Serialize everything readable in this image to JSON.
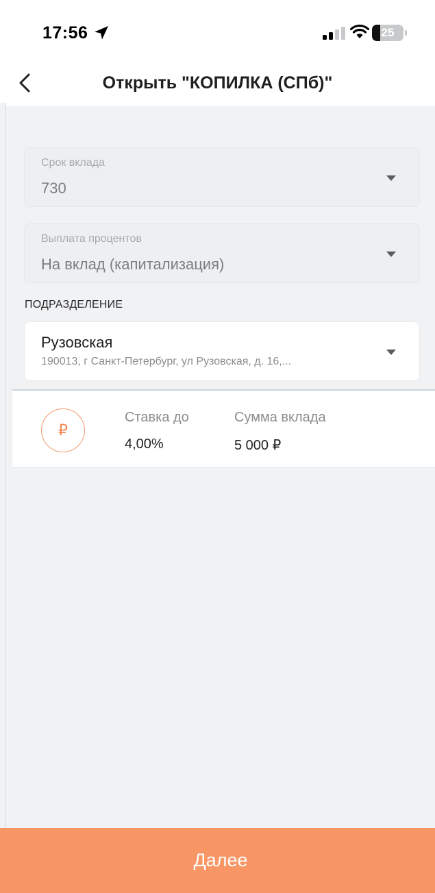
{
  "status_bar": {
    "time": "17:56",
    "battery": "25",
    "battery_level": 0.25
  },
  "header": {
    "title": "Открыть \"КОПИЛКА (СПб)\""
  },
  "form": {
    "term": {
      "label": "Срок вклада",
      "value": "730"
    },
    "interest_payment": {
      "label": "Выплата процентов",
      "value": "На вклад (капитализация)"
    },
    "branch_section_label": "ПОДРАЗДЕЛЕНИЕ",
    "branch": {
      "name": "Рузовская",
      "address": "190013, г Санкт-Петербург, ул Рузовская, д. 16,..."
    }
  },
  "summary": {
    "currency_symbol": "₽",
    "rate_label": "Ставка до",
    "rate_value": "4,00%",
    "amount_label": "Сумма вклада",
    "amount_value": "5 000 ₽"
  },
  "footer": {
    "next_label": "Далее"
  },
  "colors": {
    "accent": "#f89665",
    "background": "#f1f2f4"
  },
  "icons": {
    "back": "chevron-left-icon",
    "dropdown": "caret-down-icon",
    "location": "location-arrow-icon",
    "signal": "signal-icon",
    "wifi": "wifi-icon",
    "battery": "battery-icon"
  }
}
